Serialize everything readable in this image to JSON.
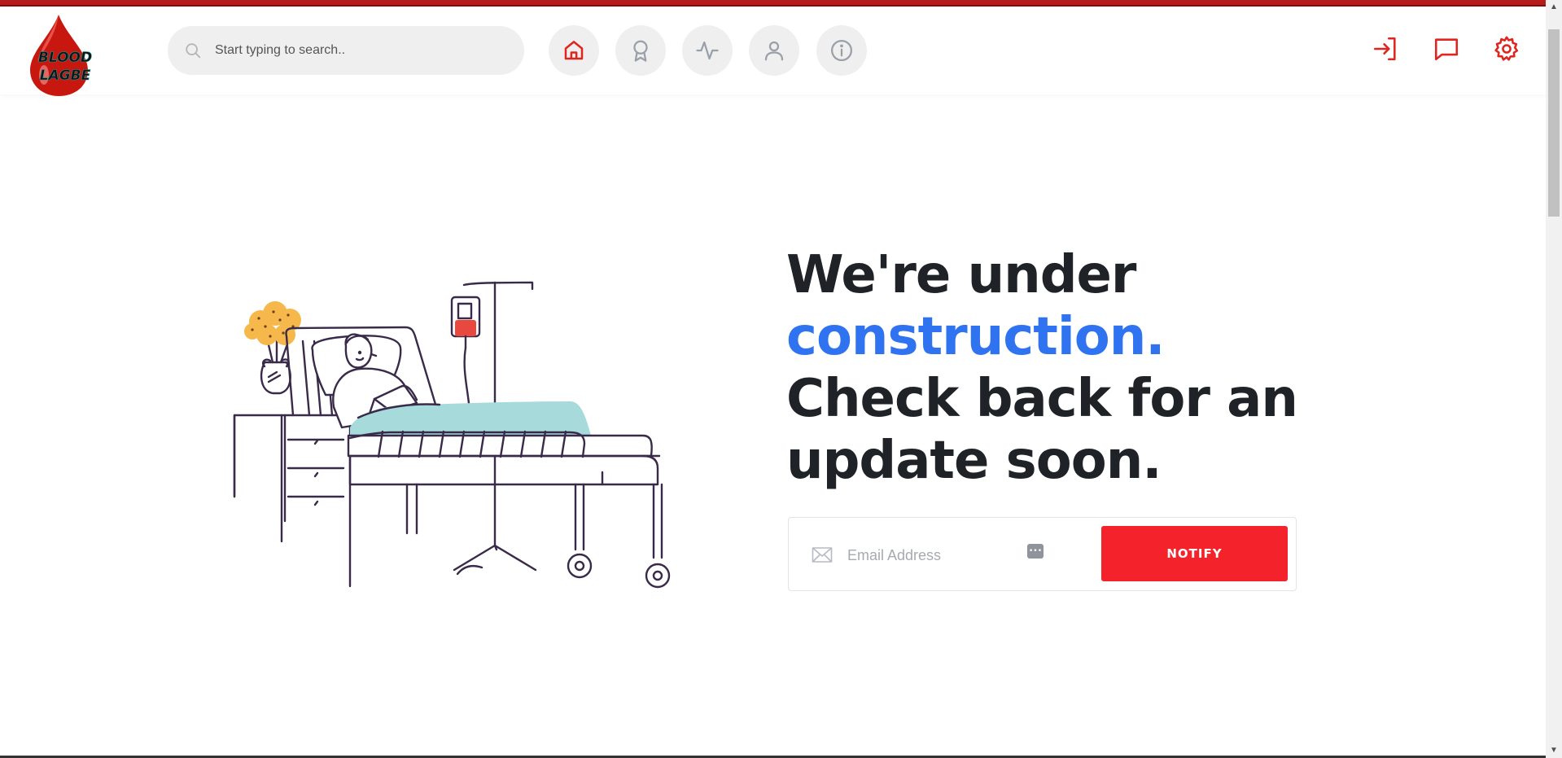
{
  "brand": {
    "logo_text_line1": "BLOOD",
    "logo_text_line2": "LAGBE",
    "accent_color": "#f4222b",
    "link_color": "#2f73f1"
  },
  "header": {
    "search_placeholder": "Start typing to search..",
    "nav_icons": [
      "home-icon",
      "award-icon",
      "activity-icon",
      "user-icon",
      "info-icon"
    ],
    "right_icons": [
      "login-icon",
      "message-icon",
      "settings-icon"
    ]
  },
  "main": {
    "headline_line1": "We're under",
    "headline_accent": "construction.",
    "headline_line3": "Check back for an",
    "headline_line4": "update soon.",
    "email_placeholder": "Email Address",
    "notify_label": "NOTIFY"
  }
}
